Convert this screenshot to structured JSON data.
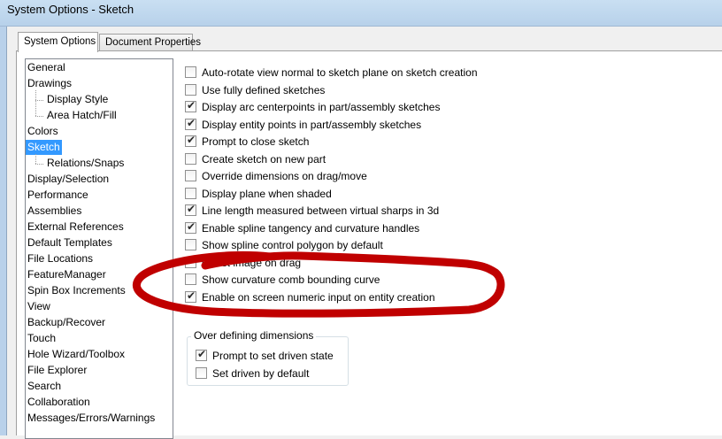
{
  "window": {
    "title": "System Options - Sketch"
  },
  "tabs": [
    {
      "label": "System Options",
      "active": true
    },
    {
      "label": "Document Properties",
      "active": false
    }
  ],
  "tree": {
    "items": [
      {
        "label": "General",
        "level": 0
      },
      {
        "label": "Drawings",
        "level": 0
      },
      {
        "label": "Display Style",
        "level": 1
      },
      {
        "label": "Area Hatch/Fill",
        "level": 1
      },
      {
        "label": "Colors",
        "level": 0
      },
      {
        "label": "Sketch",
        "level": 0,
        "selected": true
      },
      {
        "label": "Relations/Snaps",
        "level": 1
      },
      {
        "label": "Display/Selection",
        "level": 0
      },
      {
        "label": "Performance",
        "level": 0
      },
      {
        "label": "Assemblies",
        "level": 0
      },
      {
        "label": "External References",
        "level": 0
      },
      {
        "label": "Default Templates",
        "level": 0
      },
      {
        "label": "File Locations",
        "level": 0
      },
      {
        "label": "FeatureManager",
        "level": 0
      },
      {
        "label": "Spin Box Increments",
        "level": 0
      },
      {
        "label": "View",
        "level": 0
      },
      {
        "label": "Backup/Recover",
        "level": 0
      },
      {
        "label": "Touch",
        "level": 0
      },
      {
        "label": "Hole Wizard/Toolbox",
        "level": 0
      },
      {
        "label": "File Explorer",
        "level": 0
      },
      {
        "label": "Search",
        "level": 0
      },
      {
        "label": "Collaboration",
        "level": 0
      },
      {
        "label": "Messages/Errors/Warnings",
        "level": 0
      }
    ]
  },
  "options": [
    {
      "label": "Auto-rotate view normal to sketch plane on sketch creation",
      "checked": false
    },
    {
      "label": "Use fully defined sketches",
      "checked": false
    },
    {
      "label": "Display arc centerpoints in part/assembly sketches",
      "checked": true
    },
    {
      "label": "Display entity points in part/assembly sketches",
      "checked": true
    },
    {
      "label": "Prompt to close sketch",
      "checked": true
    },
    {
      "label": "Create sketch on new part",
      "checked": false
    },
    {
      "label": "Override dimensions on drag/move",
      "checked": false
    },
    {
      "label": "Display plane when shaded",
      "checked": false
    },
    {
      "label": "Line length measured between virtual sharps in 3d",
      "checked": true
    },
    {
      "label": "Enable spline tangency and curvature handles",
      "checked": true
    },
    {
      "label": "Show spline control polygon by default",
      "checked": false
    },
    {
      "label": "Ghost image on drag",
      "checked": true
    },
    {
      "label": "Show curvature comb bounding curve",
      "checked": false
    },
    {
      "label": "Enable on screen numeric input on entity creation",
      "checked": true
    }
  ],
  "overdefining": {
    "legend": "Over defining dimensions",
    "options": [
      {
        "label": "Prompt to set driven state",
        "checked": true
      },
      {
        "label": "Set driven by default",
        "checked": false
      }
    ]
  },
  "check_glyph": "✔",
  "colors": {
    "highlight_ellipse": "#c00000",
    "selection": "#3399ff"
  }
}
